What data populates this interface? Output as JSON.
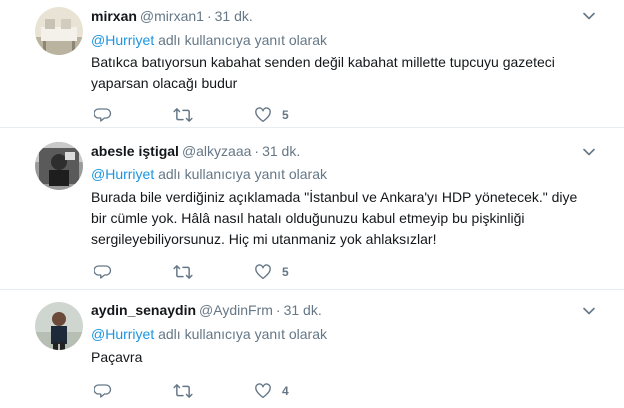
{
  "reply_prefix_separator": "",
  "tweets": [
    {
      "name": "mirxan",
      "handle": "@mirxan1",
      "separator": "·",
      "time": "31 dk.",
      "reply_mention": "@Hurriyet",
      "reply_suffix": "adlı kullanıcıya yanıt olarak",
      "text": "Batıkca batıyorsun kabahat senden değil kabahat millette tupcuyu gazeteci yaparsan olacağı budur",
      "like_count": "5"
    },
    {
      "name": "abesle iştigal",
      "handle": "@alkyzaaa",
      "separator": "·",
      "time": "31 dk.",
      "reply_mention": "@Hurriyet",
      "reply_suffix": "adlı kullanıcıya yanıt olarak",
      "text": "Burada bile verdiğiniz açıklamada \"İstanbul ve Ankara'yı HDP yönetecek.\" diye bir cümle yok. Hâlâ nasıl hatalı olduğunuzu kabul etmeyip bu pişkinliği sergileyebiliyorsunuz. Hiç mi utanmaniz yok ahlaksızlar!",
      "like_count": "5"
    },
    {
      "name": "aydin_senaydin",
      "handle": "@AydinFrm",
      "separator": "·",
      "time": "31 dk.",
      "reply_mention": "@Hurriyet",
      "reply_suffix": "adlı kullanıcıya yanıt olarak",
      "text": "Paçavra",
      "like_count": "4"
    }
  ],
  "icons": {
    "reply": "reply-icon",
    "retweet": "retweet-icon",
    "like": "heart-icon",
    "caret": "chevron-down-icon"
  },
  "colors": {
    "link": "#1b95e0",
    "secondary_text": "#657786",
    "icon": "#657786",
    "divider": "#e6ecf0"
  }
}
